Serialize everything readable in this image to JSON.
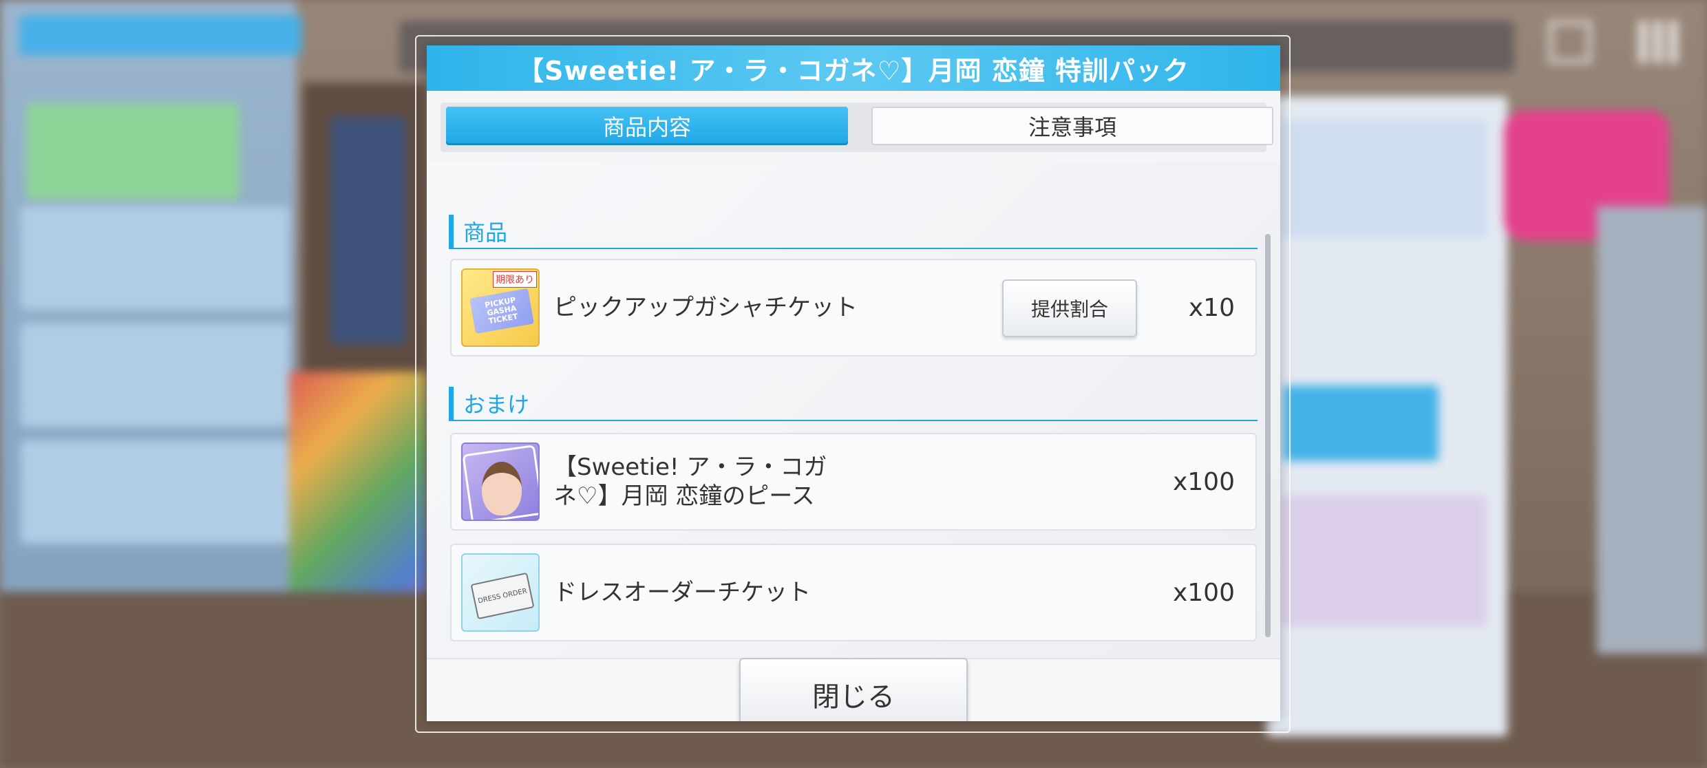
{
  "dialog": {
    "title": "【Sweetie! ア・ラ・コガネ♡】月岡 恋鐘 特訓パック",
    "tabs": [
      {
        "label": "商品内容",
        "active": true
      },
      {
        "label": "注意事項",
        "active": false
      }
    ],
    "sections": {
      "products": {
        "title": "商品",
        "items": [
          {
            "name": "ピックアップガシャチケット",
            "quantity": "x10",
            "icon": "gacha-ticket-icon",
            "icon_text": "PICKUP GASHA TICKET",
            "badge": "期限あり",
            "rate_button": "提供割合"
          }
        ]
      },
      "bonus": {
        "title": "おまけ",
        "items": [
          {
            "name": "【Sweetie! ア・ラ・コガネ♡】月岡 恋鐘のピース",
            "quantity": "x100",
            "icon": "character-piece-icon"
          },
          {
            "name": "ドレスオーダーチケット",
            "quantity": "x100",
            "icon": "dress-order-ticket-icon",
            "icon_text": "DRESS ORDER"
          }
        ]
      }
    },
    "close_label": "閉じる"
  },
  "colors": {
    "accent": "#1ea6e6",
    "header": "#2fb4ea",
    "text": "#333333"
  }
}
